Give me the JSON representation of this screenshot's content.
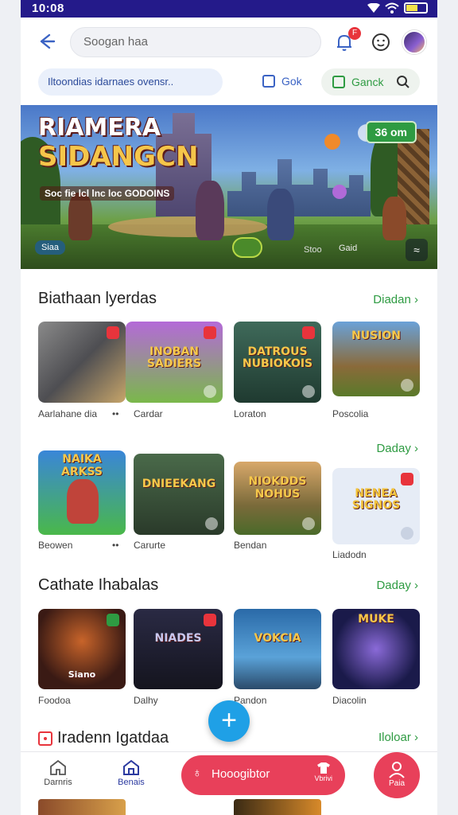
{
  "status": {
    "time": "10:08"
  },
  "topbar": {
    "search_placeholder": "Soogan haa",
    "notification_badge": "F"
  },
  "filters": {
    "pill": "Iltoondias idarnaes ovensr..",
    "check_blue": "Gok",
    "check_green": "Ganck"
  },
  "hero": {
    "title_line1": "RIAMERA",
    "title_line2": "SIDANGCN",
    "subtitle": "Soc fie lcl lnc loc GODOINS",
    "badge": "36 om",
    "chip": "Siaa",
    "mid_text": "Stoo",
    "label": "Gaid"
  },
  "section1": {
    "title": "Biathaan lyerdas",
    "link": "Diadan",
    "cards": [
      {
        "caption": "Aarlahane dia",
        "title": ""
      },
      {
        "caption": "Cardar",
        "title": "INOBAN SADIERS"
      },
      {
        "caption": "Loraton",
        "title": "DATROUS NUBIOKOIS"
      },
      {
        "caption": "Poscolia",
        "title": "NUSION"
      }
    ]
  },
  "section2": {
    "link": "Daday",
    "cards": [
      {
        "caption": "Beowen",
        "title": "NAIKA ARKSS"
      },
      {
        "caption": "Carurte",
        "title": "DNIEEKANG"
      },
      {
        "caption": "Bendan",
        "title": "NIOKDDS NOHUS"
      },
      {
        "caption": "Liadodn",
        "title": "NENEA SIGNOS"
      }
    ]
  },
  "section3": {
    "title": "Cathate Ihabalas",
    "link": "Daday",
    "cards": [
      {
        "caption": "Foodoa",
        "title": "Siano"
      },
      {
        "caption": "Dalhy",
        "title": "NIADES"
      },
      {
        "caption": "Pandon",
        "title": "VOKCIA"
      },
      {
        "caption": "Diacolin",
        "title": "MUKE"
      }
    ]
  },
  "section4": {
    "title": "Iradenn Igatdaa",
    "link": "Iloloar"
  },
  "bottomnav": {
    "home": "Darnris",
    "active": "Benais",
    "pill_label": "Hooogibtor",
    "pill_right": "Vbrivi",
    "profile": "Paia"
  },
  "colors": {
    "status_bar": "#241a8a",
    "accent_blue": "#3b63c4",
    "accent_green": "#2e9b42",
    "pill_red": "#e8405a",
    "fab": "#1fa0e6"
  }
}
